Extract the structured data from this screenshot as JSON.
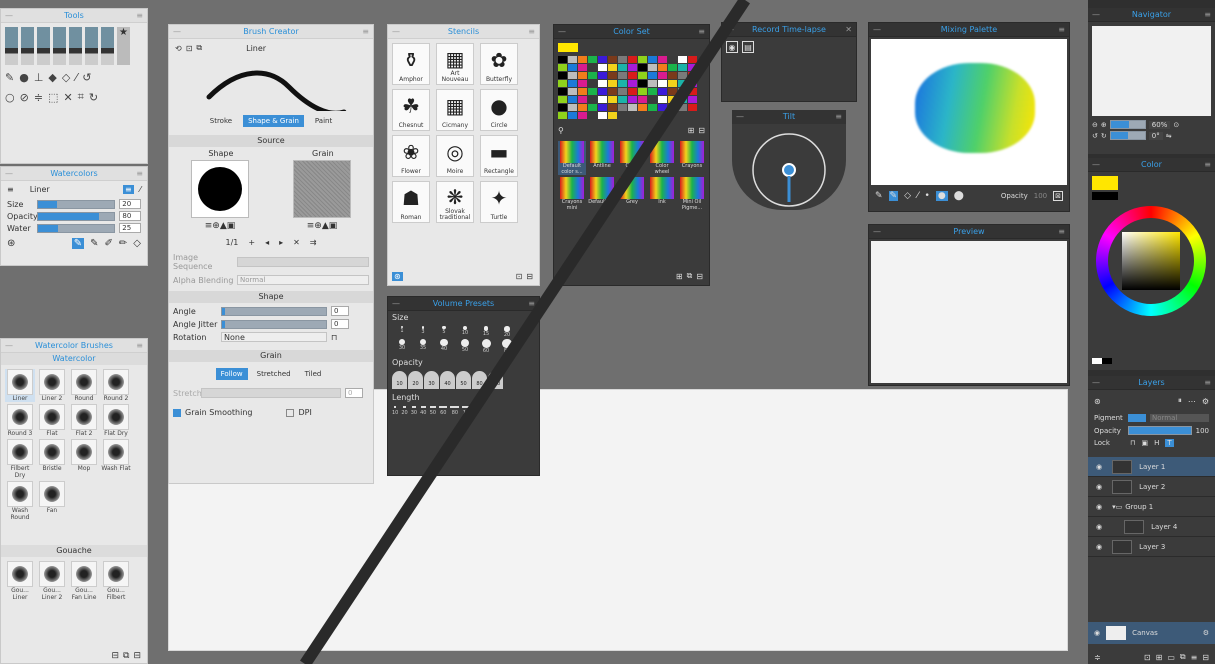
{
  "tools_panel": {
    "title": "Tools",
    "row1_icons": [
      "flat-brush-icon",
      "round-brush-icon",
      "fan-brush-icon",
      "pointed-brush-icon",
      "filbert-brush-icon",
      "mop-brush-icon",
      "bristle-brush-icon",
      "star-brush-icon"
    ],
    "row2_icons": [
      "pen-icon",
      "ink-drop-icon",
      "stamp-icon",
      "fill-icon",
      "eraser-icon",
      "pipette-icon",
      "lasso-icon"
    ],
    "row3_icons": [
      "water-drop-icon",
      "smudge-icon",
      "transform-icon",
      "selection-icon",
      "cut-icon",
      "crop-icon",
      "rotate-icon"
    ]
  },
  "watercolors_panel": {
    "title": "Watercolors",
    "brush_name": "Liner",
    "size_label": "Size",
    "size_value": "20",
    "size_fraction": 0.25,
    "opacity_label": "Opacity",
    "opacity_value": "80",
    "opacity_fraction": 0.8,
    "water_label": "Water",
    "water_value": "25",
    "water_fraction": 0.27
  },
  "watercolor_brushes_panel": {
    "title": "Watercolor Brushes",
    "group1": "Watercolor",
    "brushes1": [
      "Liner",
      "Liner 2",
      "Round",
      "Round 2",
      "Round 3",
      "Flat",
      "Flat 2",
      "Flat Dry",
      "Filbert Dry",
      "Bristle",
      "Mop",
      "Wash Flat",
      "Wash Round",
      "Fan"
    ],
    "group2": "Gouache",
    "brushes2": [
      "Gou... Liner",
      "Gou... Liner 2",
      "Gou... Fan Line",
      "Gou... Filbert"
    ]
  },
  "brush_creator": {
    "title": "Brush Creator",
    "brush_name": "Liner",
    "tabs": [
      "Stroke",
      "Shape & Grain",
      "Paint"
    ],
    "source_header": "Source",
    "shape_label": "Shape",
    "grain_label": "Grain",
    "pagination": "1/1",
    "image_sequence_label": "Image Sequence",
    "alpha_blending_label": "Alpha Blending",
    "alpha_blending_value": "Normal",
    "shape_header": "Shape",
    "angle_label": "Angle",
    "angle_value": "0",
    "angle_jitter_label": "Angle Jitter",
    "angle_jitter_value": "0",
    "rotation_label": "Rotation",
    "rotation_value": "None",
    "grain_header": "Grain",
    "grain_modes": [
      "Follow",
      "Stretched",
      "Tiled"
    ],
    "stretch_label": "Stretch",
    "stretch_value": "0",
    "grain_smoothing_label": "Grain Smoothing",
    "dpi_label": "DPI"
  },
  "stencils_panel": {
    "title": "Stencils",
    "items": [
      "Amphor",
      "Art Nouveau",
      "Butterfly",
      "Chesnut",
      "Cicmany",
      "Circle",
      "Flower",
      "Moire",
      "Rectangle",
      "Roman",
      "Slovak traditional",
      "Turtle"
    ]
  },
  "volume_presets_panel": {
    "title": "Volume Presets",
    "size_label": "Size",
    "size_values": [
      "1",
      "3",
      "5",
      "10",
      "15",
      "20",
      "30",
      "35",
      "40",
      "50",
      "60",
      "80"
    ],
    "opacity_label": "Opacity",
    "opacity_values": [
      "10",
      "20",
      "30",
      "40",
      "50",
      "80",
      "100"
    ],
    "length_label": "Length",
    "length_values": [
      "10",
      "20",
      "30",
      "40",
      "50",
      "60",
      "80",
      "100"
    ]
  },
  "color_set_panel": {
    "title": "Color Set",
    "sets": [
      "Default color s...",
      "Antline",
      "Color",
      "Color wheel",
      "Crayons",
      "Crayons mini",
      "Default set",
      "Grey",
      "Ink",
      "Mini Oil Pigme..."
    ],
    "swatch_colors": [
      "#000000",
      "#3a3a3a",
      "#7a7a7a",
      "#bdbdbd",
      "#ffffff",
      "#d81b1b",
      "#f27c1b",
      "#f2d21b",
      "#8fd11b",
      "#1bb34a",
      "#1bb3a8",
      "#1b7ad8",
      "#3b1bd8",
      "#a81bd8",
      "#d81b8f",
      "#7a3a1b"
    ]
  },
  "record_timelapse": {
    "title": "Record Time-lapse"
  },
  "tilt_panel": {
    "title": "Tilt"
  },
  "mixing_palette": {
    "title": "Mixing Palette",
    "opacity_label": "Opacity",
    "opacity_value": "100"
  },
  "preview_panel": {
    "title": "Preview"
  },
  "navigator": {
    "title": "Navigator",
    "zoom": "60%",
    "rotation": "0°"
  },
  "color_panel": {
    "title": "Color",
    "current_color": "#ffe600"
  },
  "layers_panel": {
    "title": "Layers",
    "pigment_label": "Pigment",
    "blend_mode": "Normal",
    "opacity_label": "Opacity",
    "opacity_value": "100",
    "lock_label": "Lock",
    "layers": [
      "Layer 1",
      "Layer 2",
      "Group 1",
      "Layer 4",
      "Layer 3"
    ],
    "canvas_label": "Canvas"
  },
  "colors": {
    "accent": "#3b8fd6",
    "selected": "#3d5a78",
    "yellow": "#ffe600"
  }
}
